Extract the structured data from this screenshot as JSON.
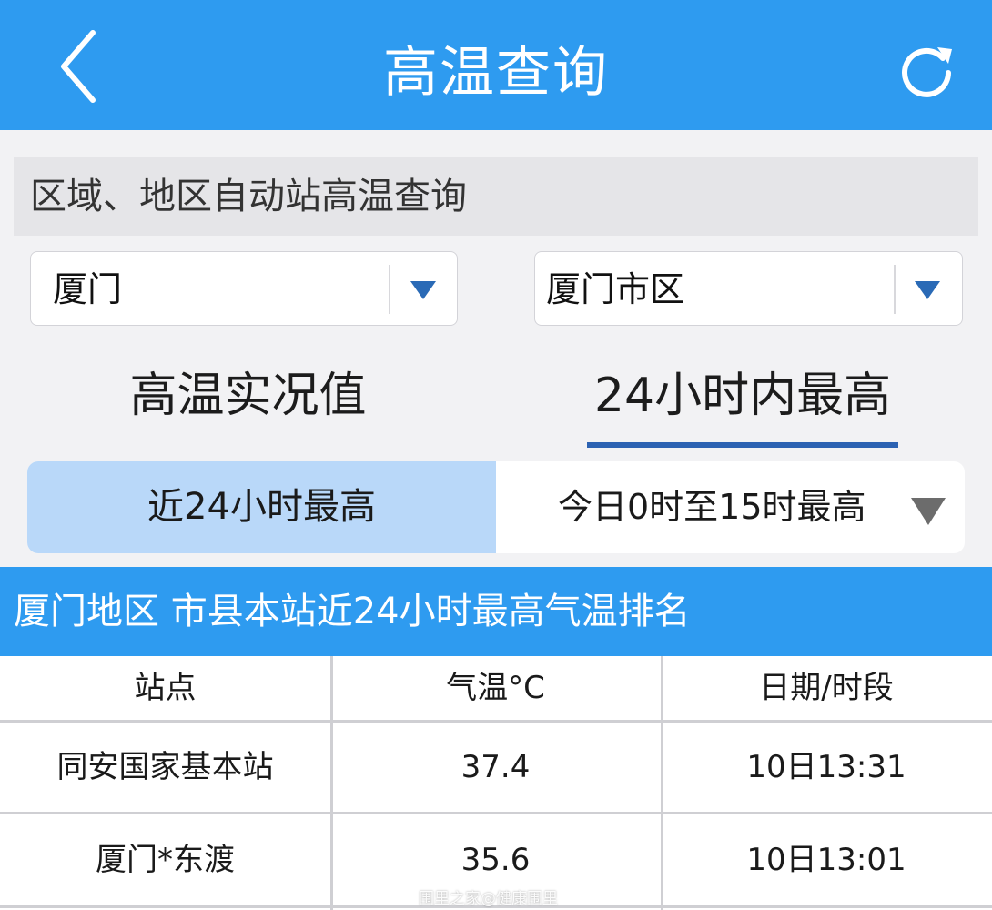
{
  "header": {
    "title": "高温查询",
    "back_icon": "chevron-left-icon",
    "refresh_icon": "refresh-icon"
  },
  "section": {
    "title": "区域、地区自动站高温查询"
  },
  "filters": {
    "region": "厦门",
    "district": "厦门市区"
  },
  "tabs": [
    {
      "label": "高温实况值",
      "active": false
    },
    {
      "label": "24小时内最高",
      "active": true
    }
  ],
  "segments": {
    "left": "近24小时最高",
    "right": "今日0时至15时最高"
  },
  "ranking": {
    "title": "厦门地区 市县本站近24小时最高气温排名"
  },
  "table": {
    "headers": [
      "站点",
      "气温°C",
      "日期/时段"
    ],
    "rows": [
      [
        "同安国家基本站",
        "37.4",
        "10日13:31"
      ],
      [
        "厦门*东渡",
        "35.6",
        "10日13:01"
      ]
    ]
  },
  "watermark": "围里之家@健康围里",
  "colors": {
    "primary": "#2e9bf0",
    "tab_underline": "#2c62b2",
    "segment_selected": "#b9d8f9",
    "select_arrow": "#2a6ab6"
  }
}
